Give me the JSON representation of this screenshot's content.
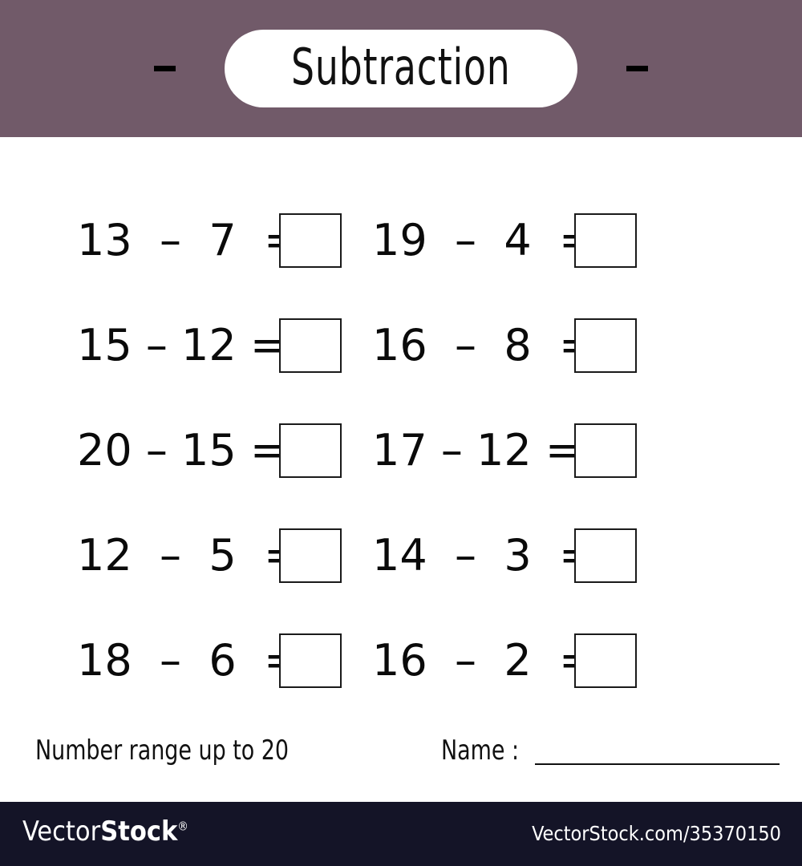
{
  "header": {
    "title": "Subtraction",
    "background_color": "#715a69",
    "pill_color": "#ffffff",
    "minus_left": "-",
    "minus_right": "-"
  },
  "worksheet": {
    "rows": [
      {
        "left": {
          "expression": "13  –  7  =",
          "minuend": 13,
          "subtrahend": 7,
          "answer": ""
        },
        "right": {
          "expression": "19  –  4  =",
          "minuend": 19,
          "subtrahend": 4,
          "answer": ""
        }
      },
      {
        "left": {
          "expression": "15 – 12 =",
          "minuend": 15,
          "subtrahend": 12,
          "answer": ""
        },
        "right": {
          "expression": "16  –  8  =",
          "minuend": 16,
          "subtrahend": 8,
          "answer": ""
        }
      },
      {
        "left": {
          "expression": "20 – 15 =",
          "minuend": 20,
          "subtrahend": 15,
          "answer": ""
        },
        "right": {
          "expression": "17 – 12 =",
          "minuend": 17,
          "subtrahend": 12,
          "answer": ""
        }
      },
      {
        "left": {
          "expression": "12  –  5  =",
          "minuend": 12,
          "subtrahend": 5,
          "answer": ""
        },
        "right": {
          "expression": "14  –  3  =",
          "minuend": 14,
          "subtrahend": 3,
          "answer": ""
        }
      },
      {
        "left": {
          "expression": "18  –  6  =",
          "minuend": 18,
          "subtrahend": 6,
          "answer": ""
        },
        "right": {
          "expression": "16  –  2  =",
          "minuend": 16,
          "subtrahend": 2,
          "answer": ""
        }
      }
    ]
  },
  "footer": {
    "range_note": "Number range up to 20",
    "name_label": "Name :",
    "name_value": ""
  },
  "watermark": {
    "logo_light": "Vector",
    "logo_bold": "Stock",
    "registered_mark": "®",
    "url": "VectorStock.com/35370150",
    "background_color": "#141427"
  }
}
